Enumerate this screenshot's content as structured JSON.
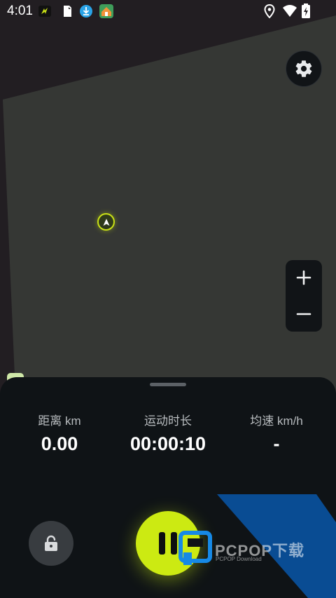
{
  "status_bar": {
    "time": "4:01",
    "left_icons": [
      "bolt-app-icon",
      "sim-card-icon",
      "download-icon",
      "home-app-icon"
    ],
    "right_icons": [
      "location-pin-icon",
      "wifi-icon",
      "battery-charging-icon"
    ]
  },
  "map": {
    "colors": {
      "outside": "#221e22",
      "region": "#353734",
      "marker": "#c8e016"
    },
    "controls": {
      "settings_icon": "gear-icon",
      "zoom_in_icon": "plus-icon",
      "zoom_out_icon": "minus-icon"
    }
  },
  "stats": [
    {
      "label": "距离 km",
      "value": "0.00"
    },
    {
      "label": "运动时长",
      "value": "00:00:10"
    },
    {
      "label": "均速 km/h",
      "value": "-"
    }
  ],
  "controls": {
    "lock_icon": "unlock-icon",
    "pause_icon": "pause-icon",
    "accent_color": "#ccea12"
  },
  "watermark": {
    "text": "PCPOP下载",
    "subtext": "PCPOP Download"
  }
}
